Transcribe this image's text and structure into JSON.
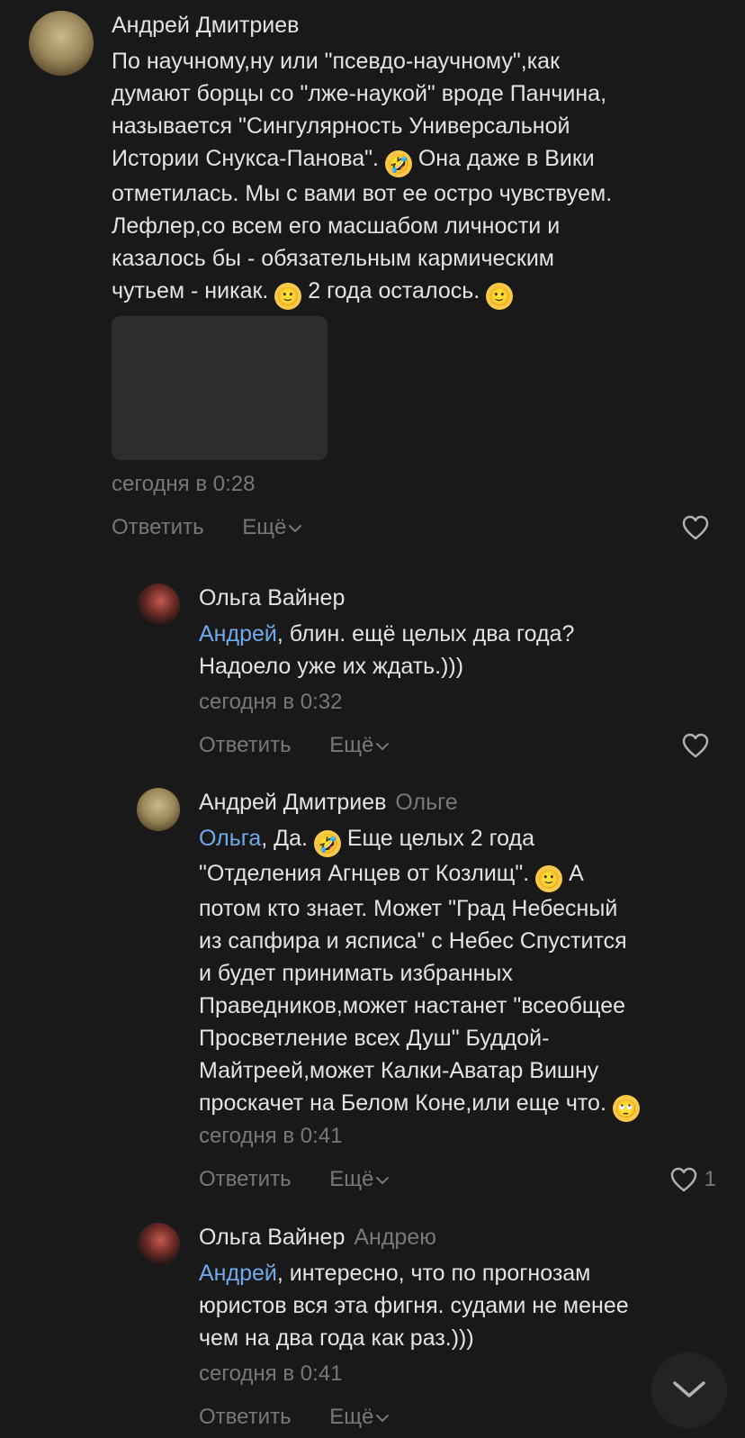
{
  "comments": [
    {
      "author": "Андрей Дмитриев",
      "reply_to": "",
      "text_parts": [
        "По научному,ну или \"псевдо-научному\",как\nдумают борцы со \"лже-наукой\" вроде Панчина,\nназывается \"Сингулярность Универсальной\nИстории Снукса-Панова\". ",
        " Она даже в Вики\nотметилась. Мы с вами вот ее остро чувствуем.\nЛефлер,со всем его масшабом личности и\nказалось бы - обязательным кармическим\nчутьем - никак. ",
        " 2 года осталось. "
      ],
      "emojis": [
        "🤣",
        "🙂",
        "🙂"
      ],
      "time": "сегодня в 0:28",
      "reply_label": "Ответить",
      "more_label": "Ещё",
      "likes": ""
    },
    {
      "author": "Ольга Вайнер",
      "reply_to": "",
      "mention": "Андрей",
      "text": ", блин. ещё целых два года?\nНадоело уже их ждать.)))",
      "time": "сегодня в 0:32",
      "reply_label": "Ответить",
      "more_label": "Ещё",
      "likes": ""
    },
    {
      "author": "Андрей Дмитриев",
      "reply_to": "Ольге",
      "mention": "Ольга",
      "text_parts": [
        ", Да. ",
        " Еще целых 2 года\n\"Отделения Агнцев от Козлищ\". ",
        " А\nпотом кто знает. Может \"Град Небесный\nиз сапфира и ясписа\" с Небес Спустится\nи будет принимать избранных\nПраведников,может настанет \"всеобщее\nПросветление всех Душ\" Буддой-\nМайтреей,может Калки-Аватар Вишну\nпроскачет на Белом Коне,или еще что. "
      ],
      "emojis": [
        "🤣",
        "🙂",
        "🙄"
      ],
      "time": "сегодня в 0:41",
      "reply_label": "Ответить",
      "more_label": "Ещё",
      "likes": "1"
    },
    {
      "author": "Ольга Вайнер",
      "reply_to": "Андрею",
      "mention": "Андрей",
      "text": ", интересно, что по прогнозам\nюристов вся эта фигня. судами не менее\nчем на два года как раз.)))",
      "time": "сегодня в 0:41",
      "reply_label": "Ответить",
      "more_label": "Ещё",
      "likes": ""
    }
  ],
  "icons": {
    "like": "heart-icon",
    "more": "chevron-down-icon",
    "scroll_down": "chevron-down-icon"
  },
  "colors": {
    "background": "#19191a",
    "text": "#e1e3e6",
    "secondary": "#76787a",
    "mention": "#71aaeb"
  }
}
